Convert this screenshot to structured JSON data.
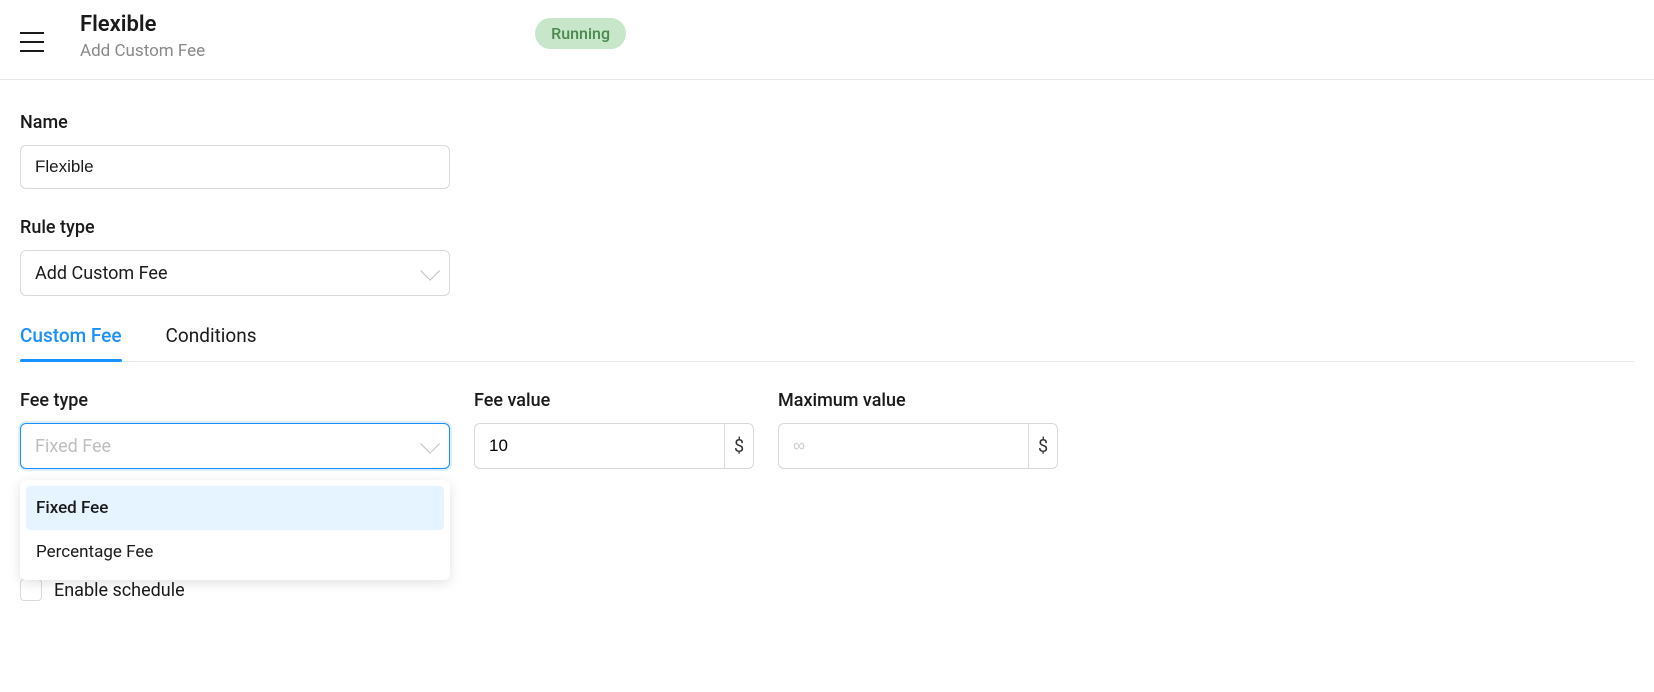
{
  "header": {
    "title": "Flexible",
    "subtitle": "Add Custom Fee",
    "status": "Running"
  },
  "form": {
    "name_label": "Name",
    "name_value": "Flexible",
    "rule_type_label": "Rule type",
    "rule_type_value": "Add Custom Fee"
  },
  "tabs": {
    "custom_fee": "Custom Fee",
    "conditions": "Conditions"
  },
  "fee": {
    "type_label": "Fee type",
    "type_placeholder": "Fixed Fee",
    "value_label": "Fee value",
    "value": "10",
    "max_label": "Maximum value",
    "max_placeholder": "∞",
    "currency": "$",
    "options": {
      "fixed": "Fixed Fee",
      "percentage": "Percentage Fee"
    }
  },
  "schedule": {
    "label": "Enable schedule"
  }
}
